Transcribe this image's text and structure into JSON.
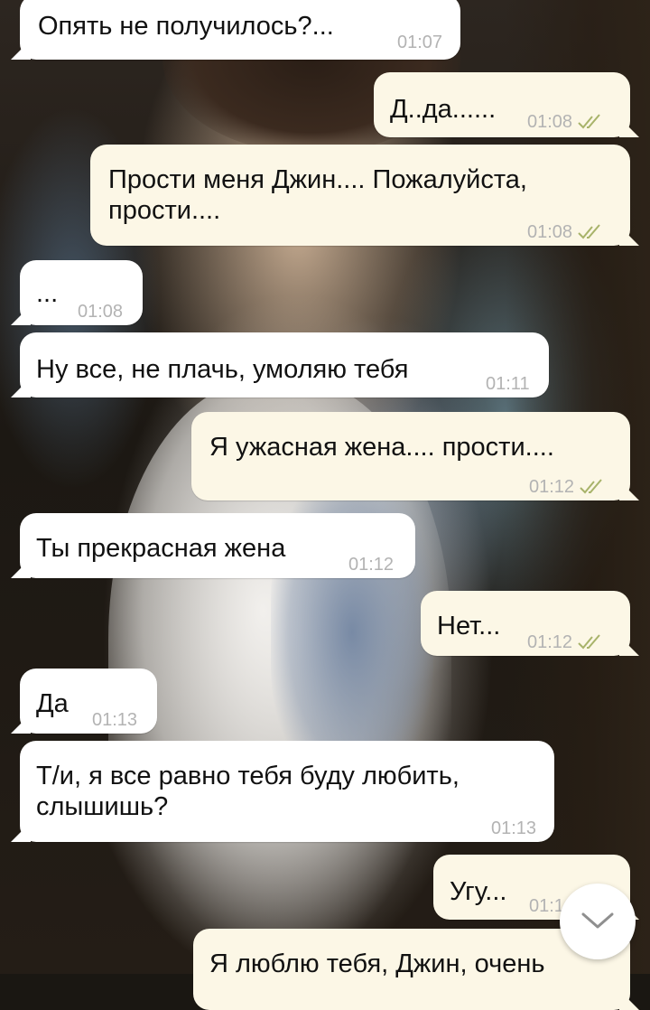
{
  "conversation": {
    "messages": [
      {
        "id": 1,
        "direction": "in",
        "text": "Опять не получилось?...",
        "time": "01:07"
      },
      {
        "id": 2,
        "direction": "out",
        "text": "Д..да......",
        "time": "01:08",
        "status": "read"
      },
      {
        "id": 3,
        "direction": "out",
        "text": "Прости меня Джин.... Пожалуйста,\nпрости....",
        "time": "01:08",
        "status": "read"
      },
      {
        "id": 4,
        "direction": "in",
        "text": "...",
        "time": "01:08"
      },
      {
        "id": 5,
        "direction": "in",
        "text": "Ну все, не плачь, умоляю тебя",
        "time": "01:11"
      },
      {
        "id": 6,
        "direction": "out",
        "text": "Я ужасная жена.... прости....",
        "time": "01:12",
        "status": "read"
      },
      {
        "id": 7,
        "direction": "in",
        "text": "Ты прекрасная жена",
        "time": "01:12"
      },
      {
        "id": 8,
        "direction": "out",
        "text": "Нет...",
        "time": "01:12",
        "status": "read"
      },
      {
        "id": 9,
        "direction": "in",
        "text": "Да",
        "time": "01:13"
      },
      {
        "id": 10,
        "direction": "in",
        "text": "Т/и, я все равно тебя буду любить,\nслышишь?",
        "time": "01:13"
      },
      {
        "id": 11,
        "direction": "out",
        "text": "Угу...",
        "time": "01:1",
        "status": "read"
      },
      {
        "id": 12,
        "direction": "out",
        "text": "Я люблю тебя, Джин, очень",
        "time": "",
        "status": ""
      }
    ]
  },
  "icons": {
    "read_receipt": "double-check-icon",
    "scroll_down": "chevron-down-icon"
  },
  "colors": {
    "incoming_bubble": "#ffffff",
    "outgoing_bubble": "#fcf7e6",
    "timestamp": "#b3b3b3"
  }
}
